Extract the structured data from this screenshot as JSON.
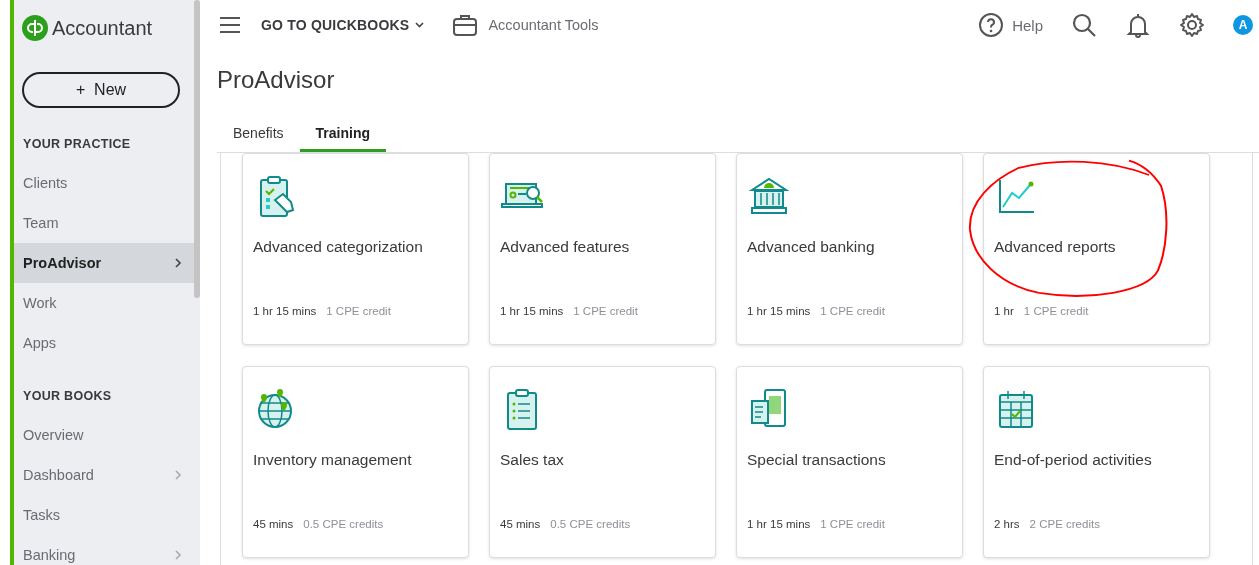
{
  "sidebar": {
    "brand": "Accountant",
    "new_button": "+  New",
    "sections": [
      {
        "heading": "YOUR PRACTICE",
        "items": [
          {
            "label": "Clients",
            "selected": false,
            "expandable": false
          },
          {
            "label": "Team",
            "selected": false,
            "expandable": false
          },
          {
            "label": "ProAdvisor",
            "selected": true,
            "expandable": true
          },
          {
            "label": "Work",
            "selected": false,
            "expandable": false
          },
          {
            "label": "Apps",
            "selected": false,
            "expandable": false
          }
        ]
      },
      {
        "heading": "YOUR BOOKS",
        "items": [
          {
            "label": "Overview",
            "selected": false,
            "expandable": false
          },
          {
            "label": "Dashboard",
            "selected": false,
            "expandable": true
          },
          {
            "label": "Tasks",
            "selected": false,
            "expandable": false
          },
          {
            "label": "Banking",
            "selected": false,
            "expandable": true
          }
        ]
      }
    ]
  },
  "topbar": {
    "go_to": "GO TO QUICKBOOKS",
    "tools": "Accountant Tools",
    "help": "Help",
    "avatar": "A"
  },
  "page": {
    "title": "ProAdvisor",
    "tabs": [
      {
        "label": "Benefits",
        "selected": false
      },
      {
        "label": "Training",
        "selected": true
      }
    ],
    "courses": [
      {
        "title": "Advanced categorization",
        "duration": "1 hr 15 mins",
        "credits": "1 CPE credit",
        "circled": false
      },
      {
        "title": "Advanced features",
        "duration": "1 hr 15 mins",
        "credits": "1 CPE credit",
        "circled": false
      },
      {
        "title": "Advanced banking",
        "duration": "1 hr 15 mins",
        "credits": "1 CPE credit",
        "circled": false
      },
      {
        "title": "Advanced reports",
        "duration": "1 hr",
        "credits": "1 CPE credit",
        "circled": true
      },
      {
        "title": "Inventory management",
        "duration": "45 mins",
        "credits": "0.5 CPE credits",
        "circled": false
      },
      {
        "title": "Sales tax",
        "duration": "45 mins",
        "credits": "0.5 CPE credits",
        "circled": false
      },
      {
        "title": "Special transactions",
        "duration": "1 hr 15 mins",
        "credits": "1 CPE credit",
        "circled": false
      },
      {
        "title": "End-of-period activities",
        "duration": "2 hrs",
        "credits": "2 CPE credits",
        "circled": false
      }
    ]
  }
}
